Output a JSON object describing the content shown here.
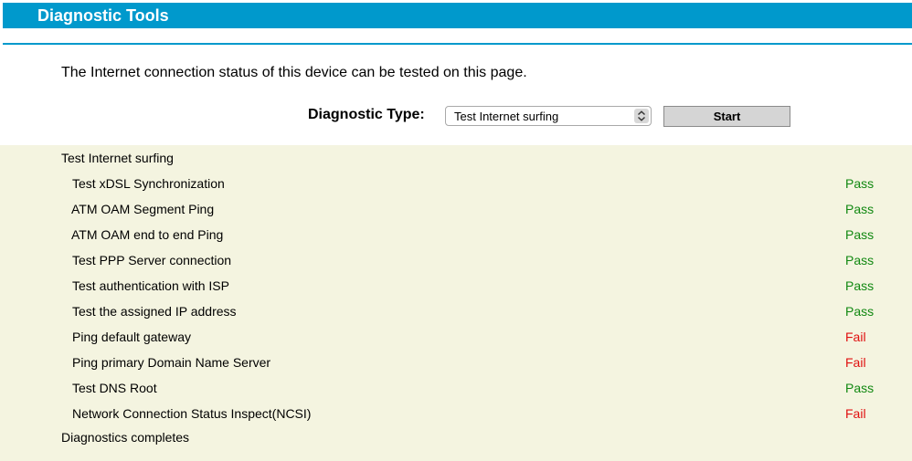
{
  "header": {
    "title": "Diagnostic Tools"
  },
  "description": "The Internet connection status of this device can be tested on this page.",
  "form": {
    "diagnostic_type_label": "Diagnostic Type:",
    "diagnostic_type_value": "Test Internet surfing",
    "start_label": "Start"
  },
  "results": {
    "header": "Test Internet surfing",
    "footer": "Diagnostics completes",
    "items": [
      {
        "name": "Test xDSL Synchronization",
        "status": "Pass"
      },
      {
        "name": "ATM OAM Segment Ping",
        "status": "Pass"
      },
      {
        "name": "ATM OAM end to end Ping",
        "status": "Pass"
      },
      {
        "name": "Test PPP Server connection",
        "status": "Pass"
      },
      {
        "name": "Test authentication with ISP",
        "status": "Pass"
      },
      {
        "name": "Test the assigned IP address",
        "status": "Pass"
      },
      {
        "name": "Ping default gateway",
        "status": "Fail"
      },
      {
        "name": "Ping primary Domain Name Server",
        "status": "Fail"
      },
      {
        "name": "Test DNS Root",
        "status": "Pass"
      },
      {
        "name": "Network Connection Status Inspect(NCSI)",
        "status": "Fail"
      }
    ]
  },
  "colors": {
    "accent": "#0099cc",
    "results_background": "#f4f4e0",
    "pass": "#118811",
    "fail": "#e01010"
  }
}
